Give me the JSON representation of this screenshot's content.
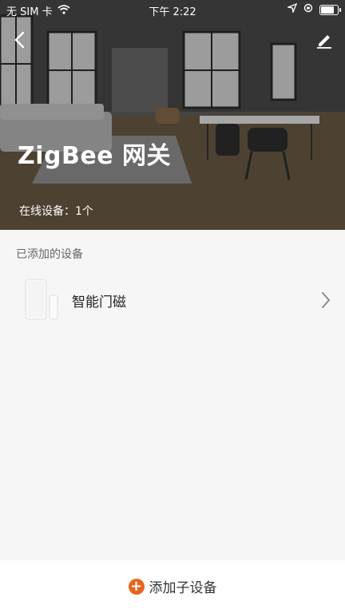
{
  "status_bar": {
    "carrier": "无 SIM 卡",
    "time": "下午 2:22",
    "battery_level": 0.9
  },
  "header": {
    "title": "ZigBee 网关",
    "online_count": "在线设备：1个",
    "back_icon": "chevron-left-icon",
    "edit_icon": "pencil-icon"
  },
  "section": {
    "label": "已添加的设备"
  },
  "devices": [
    {
      "name": "智能门磁"
    }
  ],
  "footer": {
    "add_label": "添加子设备",
    "accent_color": "#e8631c"
  }
}
